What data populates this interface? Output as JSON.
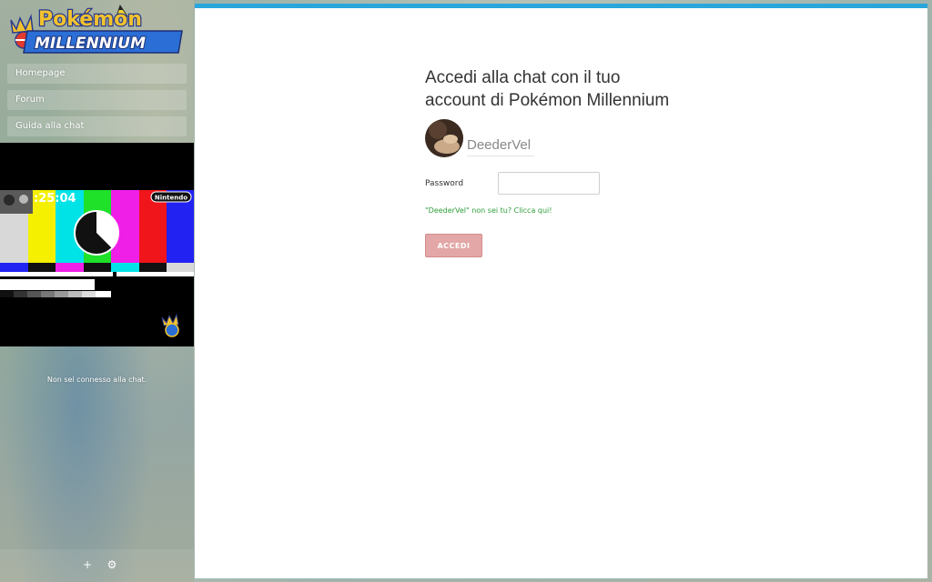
{
  "logo": {
    "line1": "Pokémon",
    "line2": "MILLENNIUM"
  },
  "nav": {
    "items": [
      {
        "label": "Homepage"
      },
      {
        "label": "Forum"
      },
      {
        "label": "Guida alla chat"
      }
    ]
  },
  "stream": {
    "timer": ":25:04",
    "brand": "Nintendo"
  },
  "chat": {
    "status": "Non sei connesso alla chat."
  },
  "bottom": {
    "add_icon": "plus-icon",
    "settings_icon": "gear-icon",
    "add_glyph": "+",
    "settings_glyph": "⚙"
  },
  "login": {
    "title_line1": "Accedi alla chat con il tuo",
    "title_line2": "account di Pokémon Millennium",
    "username": "DeederVel",
    "password_label": "Password",
    "password_value": "",
    "not_you": "\"DeederVel\" non sei tu? Clicca qui!",
    "button_label": "ACCEDI"
  },
  "colors": {
    "accent_top": "#29a6dc",
    "button_bg": "#e3a7a7",
    "link_green": "#2e9e3a"
  }
}
